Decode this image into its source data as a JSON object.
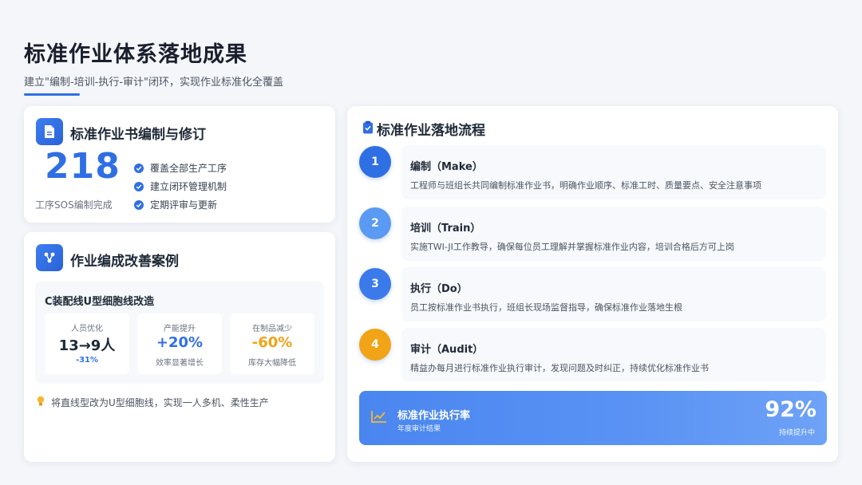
{
  "header": {
    "title": "标准作业体系落地成果",
    "subtitle": "建立\"编制-培训-执行-审计\"闭环，实现作业标准化全覆盖"
  },
  "sos_card": {
    "icon": "document-icon",
    "title": "标准作业书编制与修订",
    "big_number": "218",
    "caption": "工序SOS编制完成",
    "bullets": [
      "覆盖全部生产工序",
      "建立闭环管理机制",
      "定期评审与更新"
    ]
  },
  "case_card": {
    "icon": "network-icon",
    "title": "作业编成改善案例",
    "panel_title": "C装配线U型细胞线改造",
    "metrics": [
      {
        "label": "人员优化",
        "value": "13→9人",
        "note": "-31%"
      },
      {
        "label": "产能提升",
        "value": "+20%",
        "note": "效率显著增长"
      },
      {
        "label": "在制品减少",
        "value": "-60%",
        "note": "库存大幅降低"
      }
    ],
    "tip": "将直线型改为U型细胞线，实现一人多机、柔性生产"
  },
  "flow_card": {
    "icon": "clipboard-check-icon",
    "title": "标准作业落地流程",
    "steps": [
      {
        "num": "1",
        "title": "编制（Make）",
        "desc": "工程师与班组长共同编制标准作业书，明确作业顺序、标准工时、质量要点、安全注意事项"
      },
      {
        "num": "2",
        "title": "培训（Train）",
        "desc": "实施TWI-JI工作教导，确保每位员工理解并掌握标准作业内容，培训合格后方可上岗"
      },
      {
        "num": "3",
        "title": "执行（Do）",
        "desc": "员工按标准作业书执行，班组长现场监督指导，确保标准作业落地生根"
      },
      {
        "num": "4",
        "title": "审计（Audit）",
        "desc": "精益办每月进行标准作业执行审计，发现问题及时纠正，持续优化标准作业书"
      }
    ],
    "rate": {
      "title": "标准作业执行率",
      "sub": "年度审计结果",
      "value": "92%",
      "note": "持续提升中"
    }
  },
  "colors": {
    "primary": "#2f6fe4",
    "step1": "#2f6fe4",
    "step2": "#5b9af2",
    "step3": "#3b7aea",
    "step4": "#f0a416",
    "orange": "#f0a416"
  }
}
